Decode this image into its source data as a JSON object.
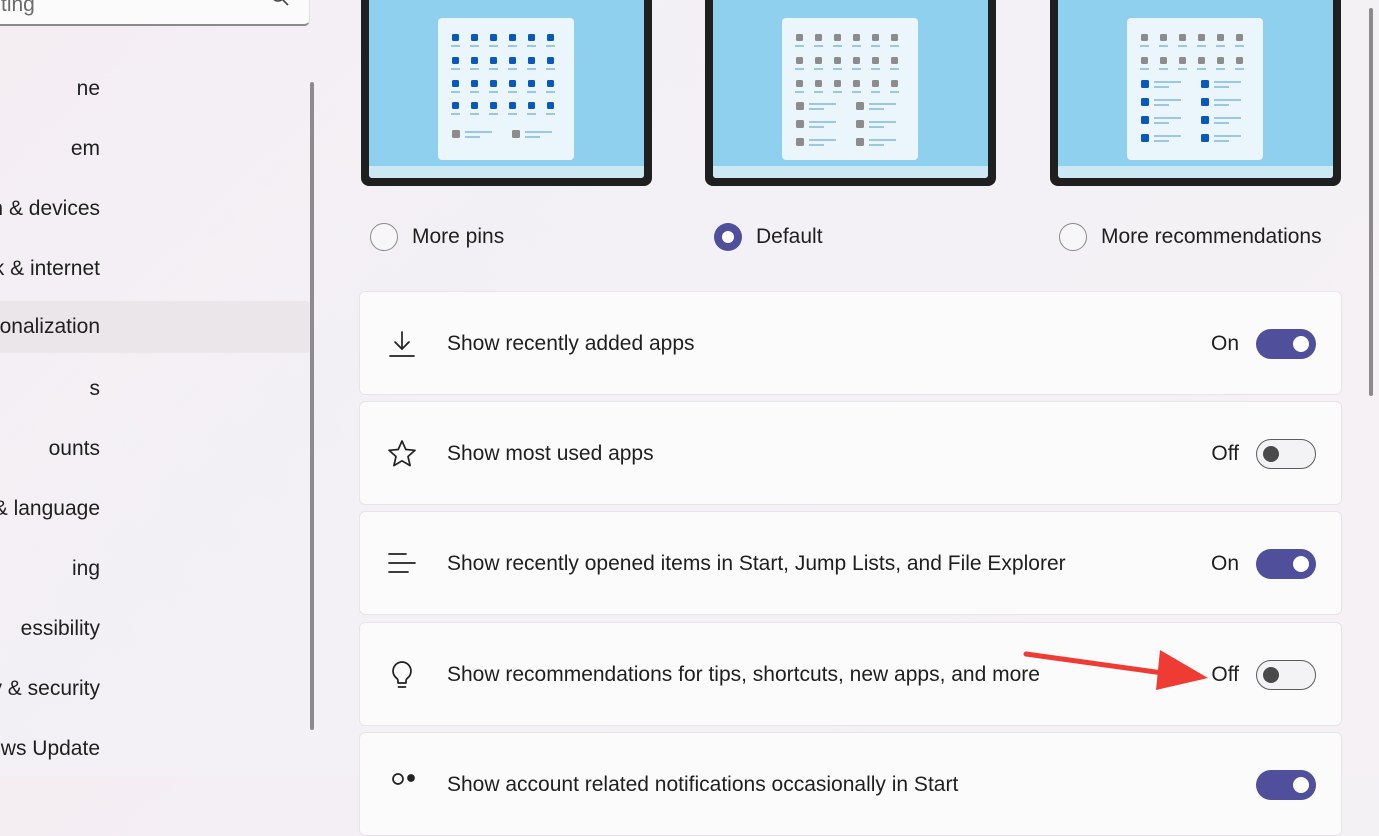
{
  "search": {
    "placeholder": "ting"
  },
  "sidebar": {
    "items": [
      {
        "label": "ne"
      },
      {
        "label": "em"
      },
      {
        "label": "tooth & devices"
      },
      {
        "label": "work & internet"
      },
      {
        "label": "onalization",
        "active": true
      },
      {
        "label": "s"
      },
      {
        "label": "ounts"
      },
      {
        "label": "e & language"
      },
      {
        "label": "ing"
      },
      {
        "label": "essibility"
      },
      {
        "label": "acy & security"
      },
      {
        "label": "dows Update"
      }
    ]
  },
  "layouts": [
    {
      "label": "More pins",
      "selected": false
    },
    {
      "label": "Default",
      "selected": true
    },
    {
      "label": "More recommendations",
      "selected": false
    }
  ],
  "settings": [
    {
      "label": "Show recently added apps",
      "state": "On",
      "on": true,
      "icon": "download-icon"
    },
    {
      "label": "Show most used apps",
      "state": "Off",
      "on": false,
      "icon": "star-icon"
    },
    {
      "label": "Show recently opened items in Start, Jump Lists, and File Explorer",
      "state": "On",
      "on": true,
      "icon": "list-icon"
    },
    {
      "label": "Show recommendations for tips, shortcuts, new apps, and more",
      "state": "Off",
      "on": false,
      "icon": "lightbulb-icon"
    },
    {
      "label": "Show account related notifications occasionally in Start",
      "state": "",
      "on": true,
      "icon": "account-icon"
    }
  ],
  "colors": {
    "accent": "#4f4f9b",
    "annotation": "#ee3b33",
    "wallpaper": "#8fd0ee"
  }
}
